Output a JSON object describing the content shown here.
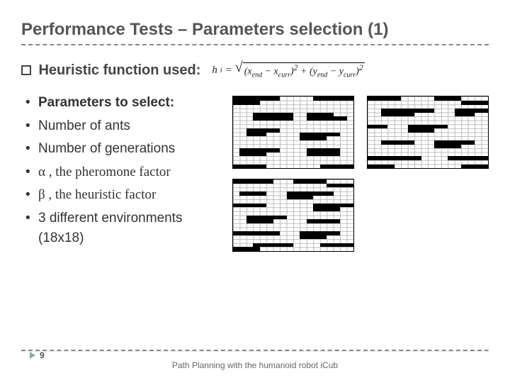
{
  "title": "Performance Tests – Parameters selection (1)",
  "heuristic_line": "Heuristic function used:",
  "formula": {
    "lhs_var": "h",
    "lhs_sub": "i",
    "eq": " = ",
    "term1a": "x",
    "term1a_sub": "end",
    "term1b": "x",
    "term1b_sub": "curr",
    "term2a": "y",
    "term2a_sub": "end",
    "term2b": "y",
    "term2b_sub": "curr"
  },
  "bullets": {
    "header": "Parameters to select:",
    "items": [
      "Number of ants",
      "Number of generations",
      "α , the pheromone factor",
      "β , the heuristic factor",
      "3 different environments (18x18)"
    ]
  },
  "grids": {
    "size": 18,
    "environments": [
      {
        "obstacles": [
          [
            0,
            0,
            7,
            1
          ],
          [
            0,
            1,
            4,
            1
          ],
          [
            12,
            0,
            6,
            1
          ],
          [
            3,
            4,
            6,
            2
          ],
          [
            11,
            4,
            4,
            1
          ],
          [
            11,
            5,
            6,
            1
          ],
          [
            2,
            8,
            5,
            1
          ],
          [
            2,
            9,
            3,
            1
          ],
          [
            10,
            9,
            6,
            1
          ],
          [
            10,
            10,
            4,
            1
          ],
          [
            1,
            13,
            6,
            1
          ],
          [
            1,
            14,
            4,
            1
          ],
          [
            11,
            13,
            5,
            2
          ],
          [
            0,
            17,
            5,
            1
          ],
          [
            13,
            17,
            5,
            1
          ]
        ]
      },
      {
        "obstacles": [
          [
            0,
            0,
            5,
            1
          ],
          [
            10,
            0,
            4,
            1
          ],
          [
            14,
            1,
            4,
            1
          ],
          [
            2,
            3,
            8,
            1
          ],
          [
            2,
            4,
            5,
            1
          ],
          [
            13,
            3,
            5,
            1
          ],
          [
            13,
            4,
            3,
            1
          ],
          [
            0,
            7,
            3,
            1
          ],
          [
            6,
            7,
            6,
            1
          ],
          [
            6,
            8,
            4,
            1
          ],
          [
            2,
            11,
            5,
            1
          ],
          [
            10,
            11,
            6,
            1
          ],
          [
            10,
            12,
            4,
            1
          ],
          [
            0,
            15,
            8,
            1
          ],
          [
            12,
            15,
            6,
            1
          ],
          [
            0,
            17,
            4,
            1
          ],
          [
            14,
            17,
            4,
            1
          ]
        ]
      },
      {
        "obstacles": [
          [
            0,
            0,
            6,
            1
          ],
          [
            9,
            0,
            5,
            1
          ],
          [
            14,
            1,
            4,
            1
          ],
          [
            1,
            3,
            4,
            1
          ],
          [
            8,
            3,
            7,
            1
          ],
          [
            8,
            4,
            4,
            1
          ],
          [
            0,
            6,
            5,
            1
          ],
          [
            12,
            6,
            6,
            1
          ],
          [
            12,
            7,
            4,
            1
          ],
          [
            2,
            9,
            6,
            1
          ],
          [
            2,
            10,
            4,
            1
          ],
          [
            11,
            10,
            5,
            1
          ],
          [
            0,
            13,
            7,
            1
          ],
          [
            10,
            13,
            6,
            1
          ],
          [
            10,
            14,
            4,
            1
          ],
          [
            3,
            16,
            6,
            1
          ],
          [
            13,
            16,
            5,
            1
          ],
          [
            0,
            17,
            4,
            1
          ]
        ]
      }
    ]
  },
  "page_number": "9",
  "footer": "Path Planning with the humanoid robot iCub"
}
